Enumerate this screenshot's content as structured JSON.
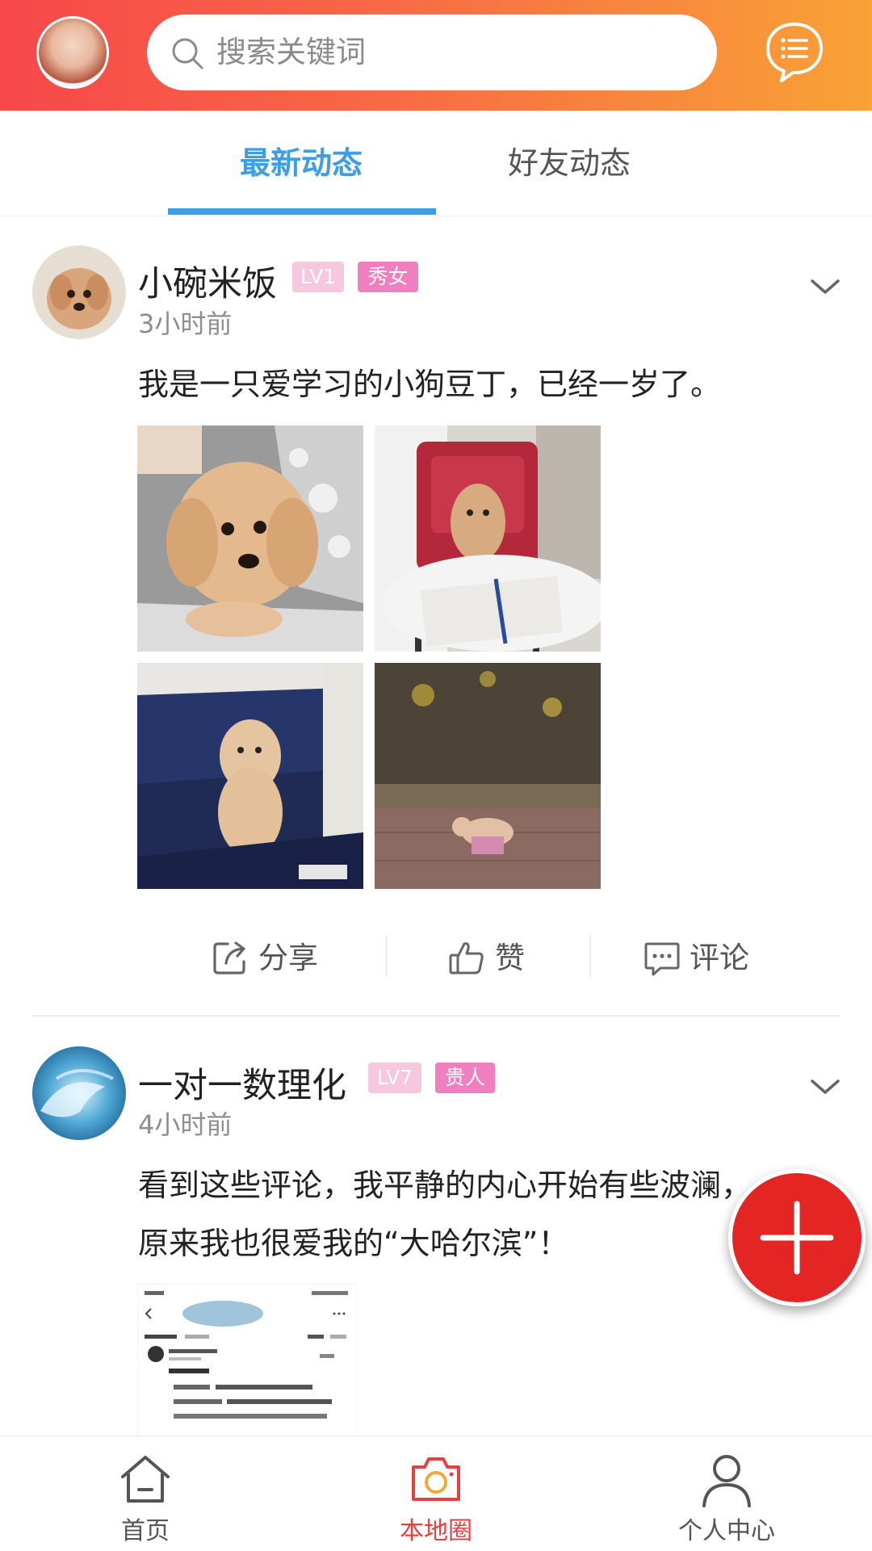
{
  "header": {
    "search_placeholder": "搜索关键词"
  },
  "tabs": [
    {
      "label": "最新动态",
      "active": true
    },
    {
      "label": "好友动态",
      "active": false
    }
  ],
  "posts": [
    {
      "user": "小碗米饭",
      "level": "LV1",
      "tag": "秀女",
      "time": "3小时前",
      "text_lines": [
        "我是一只爱学习的小狗豆丁，已经一岁了。"
      ],
      "actions": {
        "share": "分享",
        "like": "赞",
        "comment": "评论"
      }
    },
    {
      "user": "一对一数理化",
      "level": "LV7",
      "tag": "贵人",
      "time": "4小时前",
      "text_lines": [
        "看到这些评论，我平静的内心开始有些波澜，",
        "原来我也很爱我的“大哈尔滨”！"
      ]
    }
  ],
  "bottom_nav": [
    {
      "label": "首页",
      "icon": "home-icon",
      "active": false
    },
    {
      "label": "本地圈",
      "icon": "camera-icon",
      "active": true
    },
    {
      "label": "个人中心",
      "icon": "person-icon",
      "active": false
    }
  ],
  "colors": {
    "header_gradient_start": "#f7474a",
    "header_gradient_end": "#f9a236",
    "tab_active": "#3d9ee3",
    "fab": "#e32523",
    "badge_level": "#f6c8e0",
    "badge_tag": "#f07fbf"
  }
}
